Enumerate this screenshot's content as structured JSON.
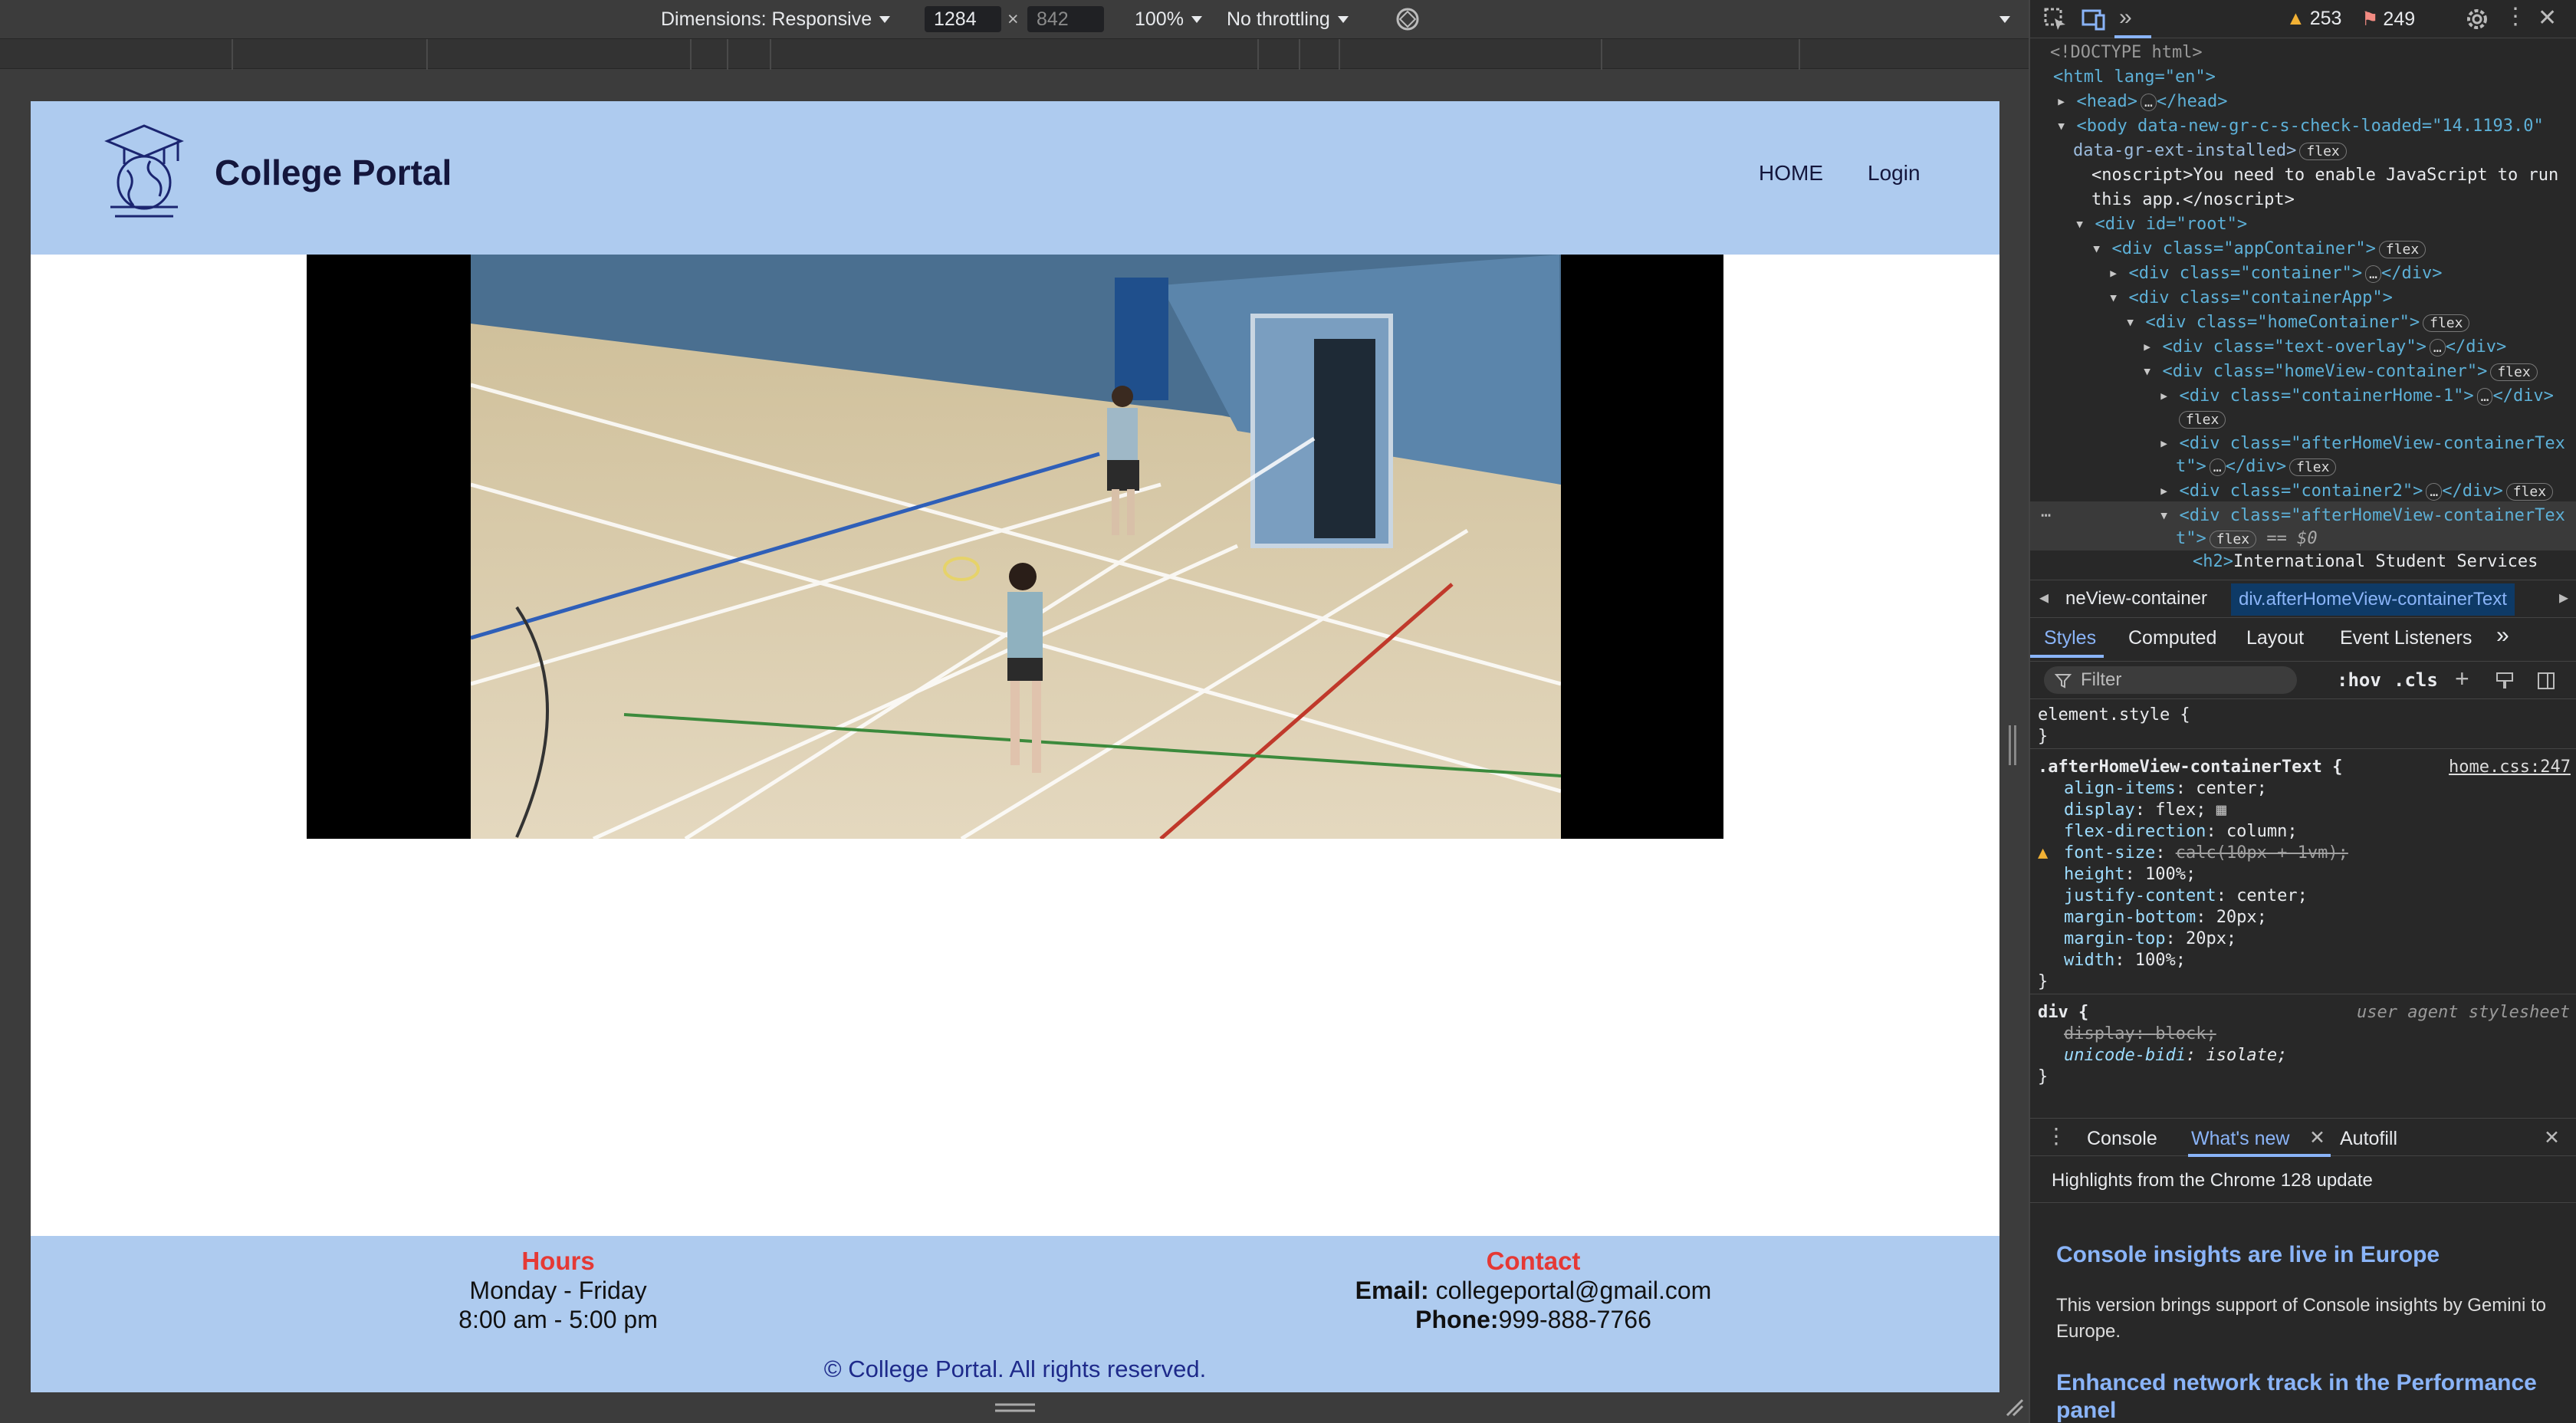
{
  "toolbar": {
    "dimensions_label": "Dimensions: Responsive",
    "width": "1284",
    "height": "842",
    "zoom": "100%",
    "throttling": "No throttling"
  },
  "site": {
    "brand": "College Portal",
    "nav": [
      "HOME",
      "Login"
    ],
    "footer": {
      "hours_heading": "Hours",
      "hours_days": "Monday - Friday",
      "hours_time": "8:00 am - 5:00 pm",
      "contact_heading": "Contact",
      "email_label": "Email:",
      "email_value": "collegeportal@gmail.com",
      "phone_label": "Phone:",
      "phone_value": "999-888-7766",
      "copyright": "© College Portal. All rights reserved."
    }
  },
  "devtools": {
    "warnings": "253",
    "errors": "249",
    "dom": [
      "<!DOCTYPE html>",
      "<html lang=\"en\">",
      "<head>",
      "</head>",
      "<body data-new-gr-c-s-check-loaded=\"14.1193.0\"",
      "data-gr-ext-installed>",
      "<noscript>You need to enable JavaScript to run",
      "this app.</noscript>",
      "<div id=\"root\">",
      "<div class=\"appContainer\">",
      "<div class=\"container\">",
      "</div>",
      "<div class=\"containerApp\">",
      "<div class=\"homeContainer\">",
      "<div class=\"text-overlay\">",
      "</div>",
      "<div class=\"homeView-container\">",
      "<div class=\"containerHome-1\">",
      "</div>",
      "<div class=\"afterHomeView-containerTex",
      "t\">",
      "</div>",
      "<div class=\"container2\">",
      "</div>",
      "<div class=\"afterHomeView-containerTex",
      "t\">",
      "== $0",
      "<h2>",
      "International Student Services"
    ],
    "flex_pill": "flex",
    "breadcrumbs": [
      "neView-container",
      "div.afterHomeView-containerText"
    ],
    "panel_tabs": [
      "Styles",
      "Computed",
      "Layout",
      "Event Listeners"
    ],
    "filter_placeholder": "Filter",
    "hov": ":hov",
    "cls": ".cls",
    "styles": {
      "element_style": "element.style {",
      "close": "}",
      "selector": ".afterHomeView-containerText {",
      "source": "home.css:247",
      "props": [
        [
          "align-items",
          "center;"
        ],
        [
          "display",
          "flex;"
        ],
        [
          "flex-direction",
          "column;"
        ],
        [
          "font-size",
          "calc(10px + 1vm);"
        ],
        [
          "height",
          "100%;"
        ],
        [
          "justify-content",
          "center;"
        ],
        [
          "margin-bottom",
          "20px;"
        ],
        [
          "margin-top",
          "20px;"
        ],
        [
          "width",
          "100%;"
        ]
      ],
      "div_selector": "div {",
      "ua_label": "user agent stylesheet",
      "div_props": [
        [
          "display",
          "block;"
        ],
        [
          "unicode-bidi",
          "isolate;"
        ]
      ]
    },
    "drawer_tabs": [
      "Console",
      "What's new",
      "Autofill"
    ],
    "drawer": {
      "highlights": "Highlights from the Chrome 128 update",
      "h1": "Console insights are live in Europe",
      "p1": "This version brings support of Console insights by Gemini to Europe.",
      "h2": "Enhanced network track in the Performance panel"
    }
  }
}
